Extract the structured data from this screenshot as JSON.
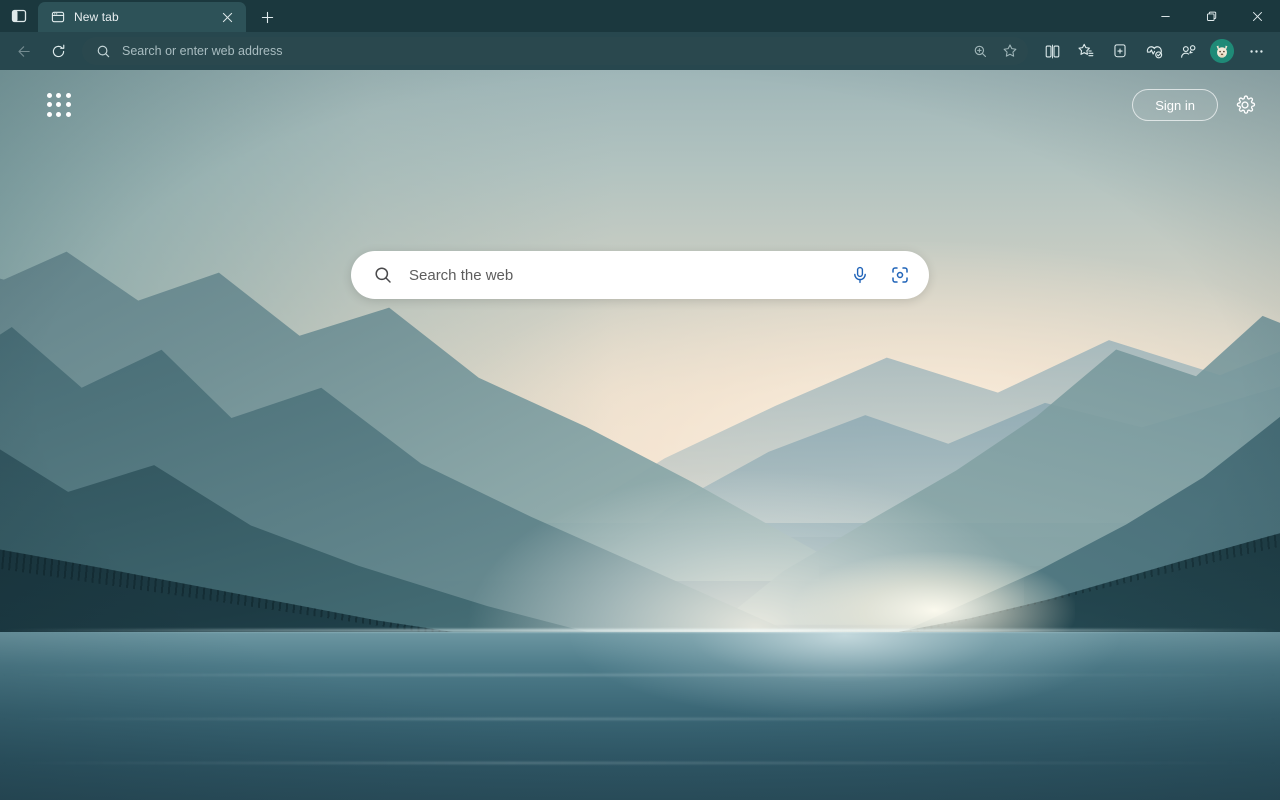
{
  "window": {
    "minimize_label": "Minimize",
    "maximize_label": "Restore Down",
    "close_label": "Close"
  },
  "tab_strip": {
    "sidebar_toggle_label": "Tab actions menu",
    "new_tab_label": "New tab (Ctrl+T)",
    "tabs": [
      {
        "title": "New tab",
        "favicon": "new-tab-page-icon",
        "close_label": "Close tab",
        "active": true
      }
    ]
  },
  "toolbar": {
    "back_label": "Back",
    "refresh_label": "Refresh",
    "address": {
      "value": "",
      "placeholder": "Search or enter web address",
      "search_icon": "search-icon"
    },
    "address_actions": [
      {
        "name": "zoom-icon",
        "label": "Zoom"
      },
      {
        "name": "favorite-star-icon",
        "label": "Add this page to favorites"
      }
    ],
    "buttons": [
      {
        "name": "split-screen-icon",
        "label": "Split screen"
      },
      {
        "name": "favorites-icon",
        "label": "Favorites"
      },
      {
        "name": "collections-icon",
        "label": "Collections"
      },
      {
        "name": "browser-essentials-icon",
        "label": "Browser essentials"
      },
      {
        "name": "copilot-icon",
        "label": "Copilot"
      }
    ],
    "avatar": {
      "label": "Profile",
      "background": "#1f8a77"
    },
    "settings_label": "Settings and more"
  },
  "page": {
    "app_launcher_label": "App launcher",
    "sign_in_label": "Sign in",
    "page_settings_label": "Page settings",
    "search": {
      "value": "",
      "placeholder": "Search the web",
      "mic_label": "Search using voice",
      "visual_search_label": "Search using an image"
    },
    "wallpaper_description": "Misty layered mountains above a calm lake at dawn"
  },
  "colors": {
    "tab_strip_bg": "#1b383e",
    "toolbar_bg": "#27474e",
    "active_tab_bg": "#2d5258",
    "address_field_bg": "#2a484e",
    "accent_blue": "#1f63b8",
    "text_light": "#e8eef0"
  }
}
